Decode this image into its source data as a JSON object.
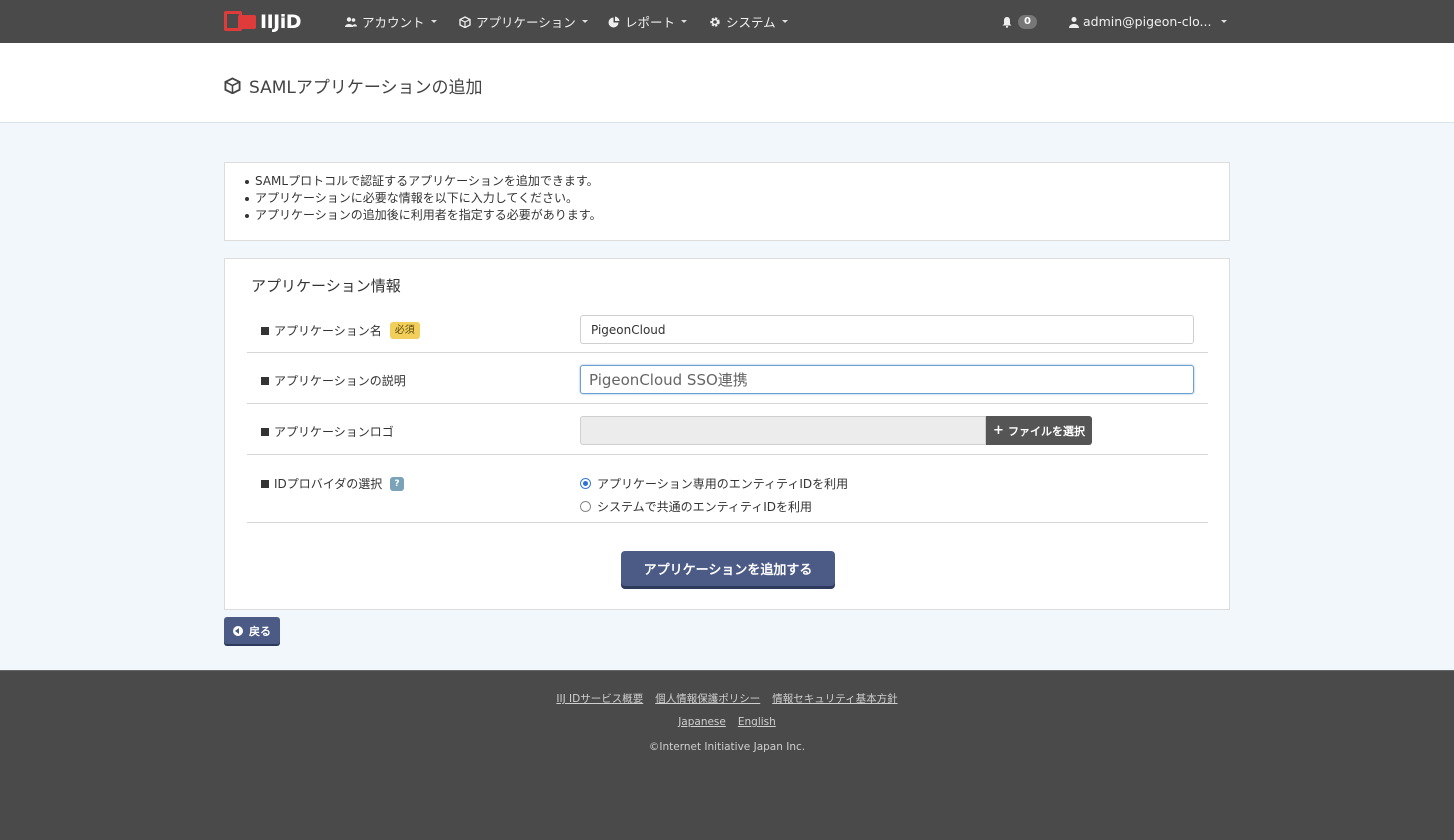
{
  "navbar": {
    "logo_text": "IIJiD",
    "items": [
      {
        "label": "アカウント",
        "icon": "users-icon"
      },
      {
        "label": "アプリケーション",
        "icon": "cube-icon"
      },
      {
        "label": "レポート",
        "icon": "pie-chart-icon"
      },
      {
        "label": "システム",
        "icon": "gear-icon"
      }
    ],
    "notification_count": "0",
    "user_label": "admin@pigeon-clo..."
  },
  "header": {
    "title": "SAMLアプリケーションの追加"
  },
  "info": {
    "lines": [
      "SAMLプロトコルで認証するアプリケーションを追加できます。",
      "アプリケーションに必要な情報を以下に入力してください。",
      "アプリケーションの追加後に利用者を指定する必要があります。"
    ]
  },
  "form": {
    "section_title": "アプリケーション情報",
    "app_name": {
      "label": "アプリケーション名",
      "required_badge": "必須",
      "value": "PigeonCloud"
    },
    "app_description": {
      "label": "アプリケーションの説明",
      "value": "PigeonCloud SSO連携"
    },
    "app_logo": {
      "label": "アプリケーションロゴ",
      "button_label": "ファイルを選択"
    },
    "idp_select": {
      "label": "IDプロバイダの選択",
      "help_badge": "?",
      "options": [
        {
          "label": "アプリケーション専用のエンティティIDを利用",
          "checked": true
        },
        {
          "label": "システムで共通のエンティティIDを利用",
          "checked": false
        }
      ]
    },
    "submit_label": "アプリケーションを追加する"
  },
  "back_label": "戻る",
  "footer": {
    "links": [
      "IIJ IDサービス概要",
      "個人情報保護ポリシー",
      "情報セキュリティ基本方針"
    ],
    "languages": [
      "Japanese",
      "English"
    ],
    "copyright": "©Internet Initiative Japan Inc."
  }
}
